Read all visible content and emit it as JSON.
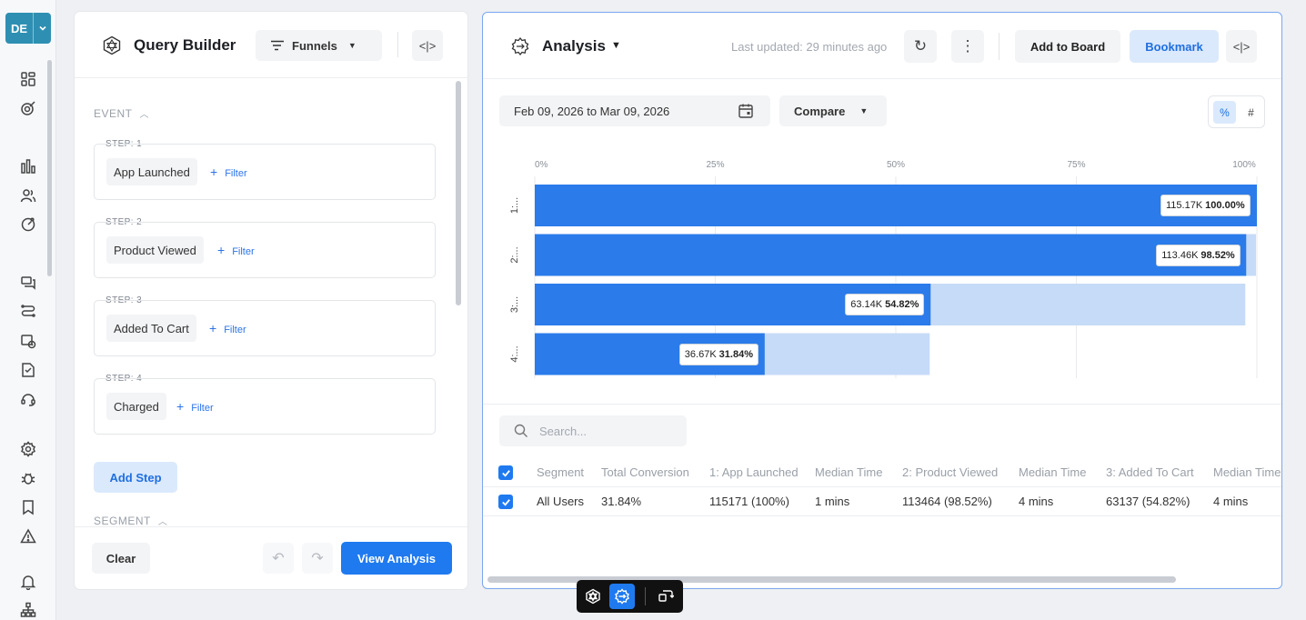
{
  "workspace": {
    "code": "DE"
  },
  "rail_icons": [
    "dashboard-icon",
    "segments-icon",
    "chart-icon",
    "users-icon",
    "live-icon",
    "messages-icon",
    "journey-icon",
    "campaign-history-icon",
    "catalog-icon",
    "support-icon",
    "settings-icon",
    "debug-icon",
    "bookmark-icon",
    "alert-icon",
    "bell-icon",
    "hierarchy-icon"
  ],
  "query_builder": {
    "title": "Query Builder",
    "mode": "Funnels",
    "event_section": "EVENT",
    "segment_section": "SEGMENT",
    "filter_label": "Filter",
    "steps": [
      {
        "label": "STEP: 1",
        "event": "App Launched"
      },
      {
        "label": "STEP: 2",
        "event": "Product Viewed"
      },
      {
        "label": "STEP: 3",
        "event": "Added To Cart"
      },
      {
        "label": "STEP: 4",
        "event": "Charged"
      }
    ],
    "add_step": "Add Step",
    "clear": "Clear",
    "view_analysis": "View Analysis"
  },
  "analysis": {
    "title": "Analysis",
    "last_updated": "Last updated: 29 minutes ago",
    "add_to_board": "Add to Board",
    "bookmark": "Bookmark",
    "date_range": "Feb 09, 2026 to Mar 09, 2026",
    "compare": "Compare",
    "toggle_pct": "%",
    "toggle_num": "#",
    "search_placeholder": "Search..."
  },
  "chart_data": {
    "type": "bar",
    "orientation": "horizontal",
    "categories": [
      "1: App Launched",
      "2: Product Viewed",
      "3: Added To Cart",
      "4: Charged"
    ],
    "tick_labels_y": [
      "1:...",
      "2:...",
      "3:...",
      "4:..."
    ],
    "x_ticks": [
      "0%",
      "25%",
      "50%",
      "75%",
      "100%"
    ],
    "xlim": [
      0,
      100
    ],
    "series": [
      {
        "values": [
          100.0,
          98.52,
          54.82,
          31.84
        ]
      }
    ],
    "previous_step_pct": [
      100,
      100,
      98.52,
      54.82
    ],
    "counts": [
      "115.17K",
      "113.46K",
      "63.14K",
      "36.67K"
    ],
    "pct_labels": [
      "100.00%",
      "98.52%",
      "54.82%",
      "31.84%"
    ],
    "colors": {
      "bar": "#2b7bea",
      "drop": "#c6dbf7",
      "grid": "#e8eaee"
    }
  },
  "table": {
    "columns": [
      "Segment",
      "Total Conversion",
      "1: App Launched",
      "Median Time",
      "2: Product Viewed",
      "Median Time",
      "3: Added To Cart",
      "Median Time"
    ],
    "rows": [
      [
        "All Users",
        "31.84%",
        "115171 (100%)",
        "1 mins",
        "113464 (98.52%)",
        "4 mins",
        "63137 (54.82%)",
        "4 mins"
      ]
    ]
  }
}
